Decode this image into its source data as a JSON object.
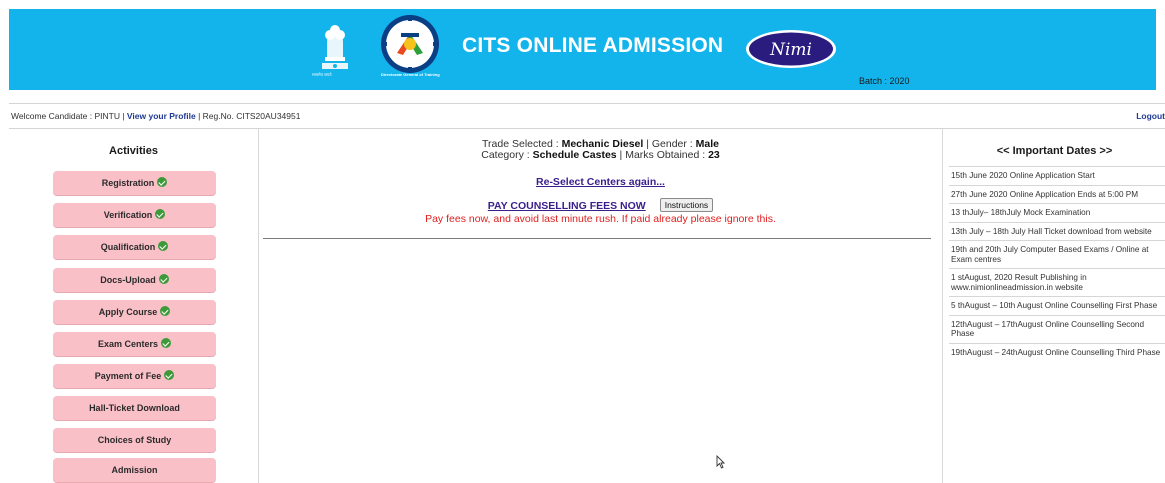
{
  "header": {
    "title": "CITS ONLINE ADMISSION",
    "batch": "Batch : 2020",
    "nimi_logo_text": "Nimi",
    "emblem_caption": "सत्यमेव जयते",
    "dgt_caption": "Directorate General of Training",
    "colors": {
      "banner": "#13b4ec"
    }
  },
  "welcome": {
    "prefix": "Welcome Candidate : PINTU | ",
    "profile_link": "View your Profile",
    "reg": " | Reg.No. CITS20AU34951",
    "logout": "Logout"
  },
  "activities": {
    "title": "Activities",
    "items": [
      {
        "label": "Registration",
        "icon": "check-icon",
        "done": true
      },
      {
        "label": "Verification",
        "icon": "check-icon",
        "done": true
      },
      {
        "label": "Qualification",
        "icon": "check-icon",
        "done": true
      },
      {
        "label": "Docs-Upload",
        "icon": "check-icon",
        "done": true
      },
      {
        "label": "Apply Course",
        "icon": "check-icon",
        "done": true
      },
      {
        "label": "Exam Centers",
        "icon": "check-icon",
        "done": true
      },
      {
        "label": "Payment of Fee",
        "icon": "check-icon",
        "done": true
      },
      {
        "label": "Hall-Ticket Download",
        "done": false
      },
      {
        "label": "Choices of Study",
        "done": false
      },
      {
        "label": "Admission",
        "done": false
      }
    ]
  },
  "center": {
    "trade_label": "Trade Selected : ",
    "trade_value": "Mechanic Diesel",
    "gender_label": " | Gender : ",
    "gender_value": "Male",
    "category_label": "Category : ",
    "category_value": "Schedule Castes",
    "marks_label": " | Marks Obtained : ",
    "marks_value": "23",
    "reselect_link": "Re-Select Centers again...",
    "pay_link": "PAY COUNSELLING FEES NOW",
    "instructions_button": "Instructions",
    "pay_note": "Pay fees now, and avoid last minute rush. If paid already please ignore this."
  },
  "important_dates": {
    "title": "<< Important Dates >>",
    "items": [
      "15th June 2020 Online Application Start",
      "27th June 2020 Online Application Ends at 5:00 PM",
      "13 thJuly– 18thJuly Mock Examination",
      "13th July – 18th July Hall Ticket download from website",
      "19th and 20th July Computer Based Exams / Online at Exam centres",
      "1 stAugust, 2020 Result Publishing in www.nimionlineadmission.in website",
      "5 thAugust – 10th August Online Counselling First Phase",
      "12thAugust – 17thAugust Online Counselling Second Phase",
      "19thAugust – 24thAugust Online Counselling Third Phase"
    ]
  }
}
